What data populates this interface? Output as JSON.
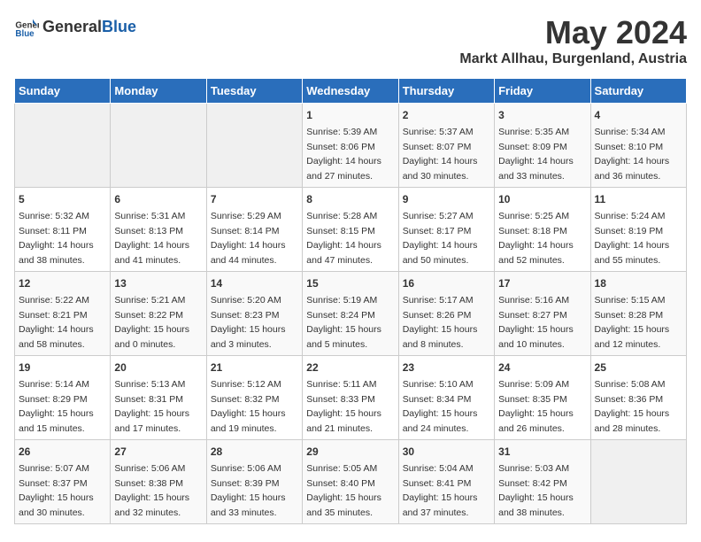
{
  "header": {
    "logo_general": "General",
    "logo_blue": "Blue",
    "title": "May 2024",
    "subtitle": "Markt Allhau, Burgenland, Austria"
  },
  "days_of_week": [
    "Sunday",
    "Monday",
    "Tuesday",
    "Wednesday",
    "Thursday",
    "Friday",
    "Saturday"
  ],
  "weeks": [
    [
      {
        "day": "",
        "info": ""
      },
      {
        "day": "",
        "info": ""
      },
      {
        "day": "",
        "info": ""
      },
      {
        "day": "1",
        "info": "Sunrise: 5:39 AM\nSunset: 8:06 PM\nDaylight: 14 hours\nand 27 minutes."
      },
      {
        "day": "2",
        "info": "Sunrise: 5:37 AM\nSunset: 8:07 PM\nDaylight: 14 hours\nand 30 minutes."
      },
      {
        "day": "3",
        "info": "Sunrise: 5:35 AM\nSunset: 8:09 PM\nDaylight: 14 hours\nand 33 minutes."
      },
      {
        "day": "4",
        "info": "Sunrise: 5:34 AM\nSunset: 8:10 PM\nDaylight: 14 hours\nand 36 minutes."
      }
    ],
    [
      {
        "day": "5",
        "info": "Sunrise: 5:32 AM\nSunset: 8:11 PM\nDaylight: 14 hours\nand 38 minutes."
      },
      {
        "day": "6",
        "info": "Sunrise: 5:31 AM\nSunset: 8:13 PM\nDaylight: 14 hours\nand 41 minutes."
      },
      {
        "day": "7",
        "info": "Sunrise: 5:29 AM\nSunset: 8:14 PM\nDaylight: 14 hours\nand 44 minutes."
      },
      {
        "day": "8",
        "info": "Sunrise: 5:28 AM\nSunset: 8:15 PM\nDaylight: 14 hours\nand 47 minutes."
      },
      {
        "day": "9",
        "info": "Sunrise: 5:27 AM\nSunset: 8:17 PM\nDaylight: 14 hours\nand 50 minutes."
      },
      {
        "day": "10",
        "info": "Sunrise: 5:25 AM\nSunset: 8:18 PM\nDaylight: 14 hours\nand 52 minutes."
      },
      {
        "day": "11",
        "info": "Sunrise: 5:24 AM\nSunset: 8:19 PM\nDaylight: 14 hours\nand 55 minutes."
      }
    ],
    [
      {
        "day": "12",
        "info": "Sunrise: 5:22 AM\nSunset: 8:21 PM\nDaylight: 14 hours\nand 58 minutes."
      },
      {
        "day": "13",
        "info": "Sunrise: 5:21 AM\nSunset: 8:22 PM\nDaylight: 15 hours\nand 0 minutes."
      },
      {
        "day": "14",
        "info": "Sunrise: 5:20 AM\nSunset: 8:23 PM\nDaylight: 15 hours\nand 3 minutes."
      },
      {
        "day": "15",
        "info": "Sunrise: 5:19 AM\nSunset: 8:24 PM\nDaylight: 15 hours\nand 5 minutes."
      },
      {
        "day": "16",
        "info": "Sunrise: 5:17 AM\nSunset: 8:26 PM\nDaylight: 15 hours\nand 8 minutes."
      },
      {
        "day": "17",
        "info": "Sunrise: 5:16 AM\nSunset: 8:27 PM\nDaylight: 15 hours\nand 10 minutes."
      },
      {
        "day": "18",
        "info": "Sunrise: 5:15 AM\nSunset: 8:28 PM\nDaylight: 15 hours\nand 12 minutes."
      }
    ],
    [
      {
        "day": "19",
        "info": "Sunrise: 5:14 AM\nSunset: 8:29 PM\nDaylight: 15 hours\nand 15 minutes."
      },
      {
        "day": "20",
        "info": "Sunrise: 5:13 AM\nSunset: 8:31 PM\nDaylight: 15 hours\nand 17 minutes."
      },
      {
        "day": "21",
        "info": "Sunrise: 5:12 AM\nSunset: 8:32 PM\nDaylight: 15 hours\nand 19 minutes."
      },
      {
        "day": "22",
        "info": "Sunrise: 5:11 AM\nSunset: 8:33 PM\nDaylight: 15 hours\nand 21 minutes."
      },
      {
        "day": "23",
        "info": "Sunrise: 5:10 AM\nSunset: 8:34 PM\nDaylight: 15 hours\nand 24 minutes."
      },
      {
        "day": "24",
        "info": "Sunrise: 5:09 AM\nSunset: 8:35 PM\nDaylight: 15 hours\nand 26 minutes."
      },
      {
        "day": "25",
        "info": "Sunrise: 5:08 AM\nSunset: 8:36 PM\nDaylight: 15 hours\nand 28 minutes."
      }
    ],
    [
      {
        "day": "26",
        "info": "Sunrise: 5:07 AM\nSunset: 8:37 PM\nDaylight: 15 hours\nand 30 minutes."
      },
      {
        "day": "27",
        "info": "Sunrise: 5:06 AM\nSunset: 8:38 PM\nDaylight: 15 hours\nand 32 minutes."
      },
      {
        "day": "28",
        "info": "Sunrise: 5:06 AM\nSunset: 8:39 PM\nDaylight: 15 hours\nand 33 minutes."
      },
      {
        "day": "29",
        "info": "Sunrise: 5:05 AM\nSunset: 8:40 PM\nDaylight: 15 hours\nand 35 minutes."
      },
      {
        "day": "30",
        "info": "Sunrise: 5:04 AM\nSunset: 8:41 PM\nDaylight: 15 hours\nand 37 minutes."
      },
      {
        "day": "31",
        "info": "Sunrise: 5:03 AM\nSunset: 8:42 PM\nDaylight: 15 hours\nand 38 minutes."
      },
      {
        "day": "",
        "info": ""
      }
    ]
  ]
}
